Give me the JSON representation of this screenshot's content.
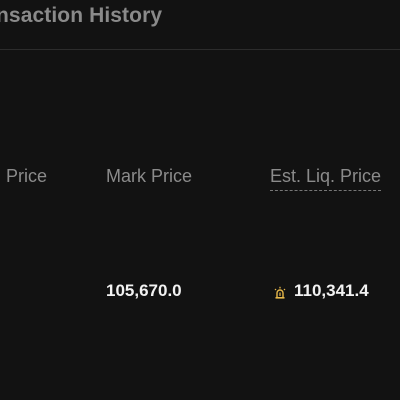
{
  "header": {
    "tab_title": "nsaction History"
  },
  "table": {
    "columns": [
      {
        "label": "n Price"
      },
      {
        "label": "Mark Price"
      },
      {
        "label": "Est. Liq. Price"
      }
    ],
    "rows": [
      {
        "mark_price": "105,670.0",
        "est_liq_price": "110,341.4",
        "liq_icon": "alarm-warning-icon"
      }
    ]
  },
  "colors": {
    "background": "#121212",
    "header_text": "#8b8b8b",
    "value_text": "#f2f2f2",
    "warning_icon": "#e8b94a",
    "divider": "#2c2c2c"
  }
}
